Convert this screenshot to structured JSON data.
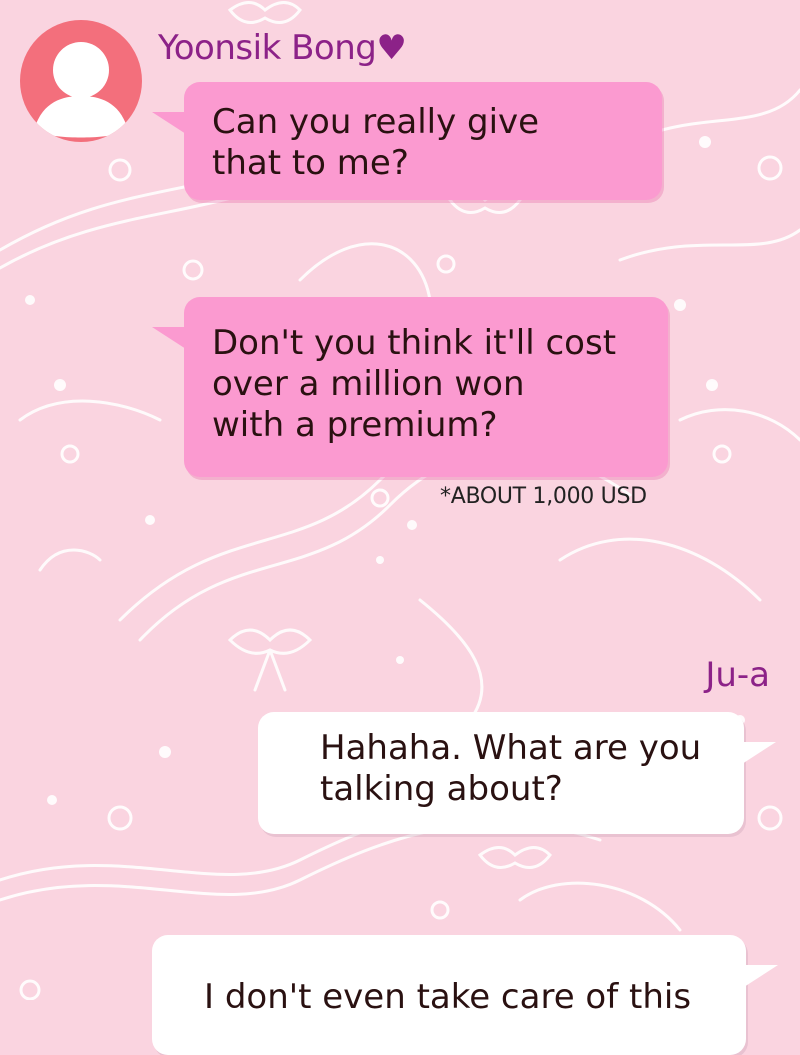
{
  "messages": [
    {
      "sender": "Yoonsik Bong♥",
      "lines": [
        "Can you really give",
        "that to me?"
      ]
    },
    {
      "lines": [
        "Don't you think it'll cost",
        "over a million won",
        "with a premium?"
      ],
      "note": "*ABOUT 1,000 USD"
    },
    {
      "sender": "Ju-a",
      "lines": [
        "Hahaha. What are you",
        "talking about?"
      ]
    },
    {
      "lines": [
        "I don't even take care of this"
      ]
    }
  ],
  "colors": {
    "background": "#fad4e0",
    "incoming_bubble": "#fb9ad0",
    "outgoing_bubble": "#ffffff",
    "name_text": "#8c2288",
    "avatar": "#f36f7c"
  }
}
